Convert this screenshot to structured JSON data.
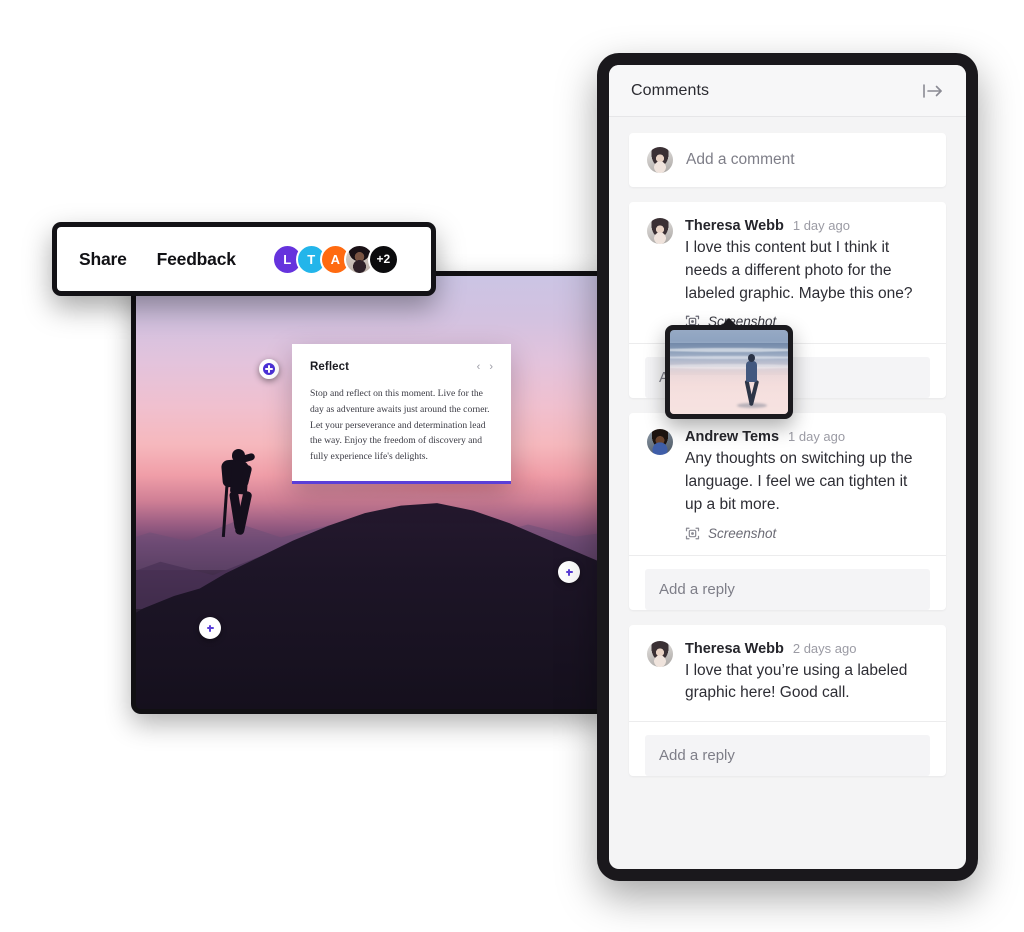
{
  "toolbar": {
    "share_label": "Share",
    "feedback_label": "Feedback",
    "avatars": [
      {
        "initial": "L",
        "color": "#6633dd",
        "type": "initial"
      },
      {
        "initial": "T",
        "color": "#23b5ea",
        "type": "initial"
      },
      {
        "initial": "A",
        "color": "#ff6a10",
        "type": "initial"
      },
      {
        "initial": "",
        "color": "#b9aea6",
        "type": "photo"
      },
      {
        "initial": "+2",
        "color": "#000000",
        "type": "count"
      }
    ]
  },
  "reflect_card": {
    "title": "Reflect",
    "prev_icon": "‹",
    "next_icon": "›",
    "body": "Stop and reflect on this moment. Live for the day as adventure awaits just around the corner. Let your perseverance and determination lead the way. Enjoy the freedom of discovery and fully experience life's delights."
  },
  "hotspots": [
    {
      "id": "hotspot-1",
      "state": "active"
    },
    {
      "id": "hotspot-2",
      "state": "inactive"
    },
    {
      "id": "hotspot-3",
      "state": "inactive"
    }
  ],
  "panel": {
    "title": "Comments",
    "collapse_icon": "collapse-panel-icon",
    "composer": {
      "placeholder": "Add a comment",
      "avatar": "theresa-webb-avatar"
    },
    "comments": [
      {
        "author": "Theresa Webb",
        "time": "1 day ago",
        "text": "I love this content but I think it needs a different photo for the labeled graphic. Maybe this one?",
        "attachment_label": "Screenshot",
        "attachment_active": true,
        "reply_placeholder": "Add a reply"
      },
      {
        "author": "Andrew Tems",
        "time": "1 day ago",
        "text": "Any thoughts on switching up the language. I feel we can tighten it up a bit more.",
        "attachment_label": "Screenshot",
        "attachment_active": false,
        "reply_placeholder": "Add a reply"
      },
      {
        "author": "Theresa Webb",
        "time": "2 days ago",
        "text": "I love that you’re using a labeled graphic here! Good call.",
        "attachment_label": "",
        "attachment_active": false,
        "reply_placeholder": "Add a reply"
      }
    ],
    "screenshot_preview": {
      "alt": "Person walking on a beach at dusk"
    }
  }
}
